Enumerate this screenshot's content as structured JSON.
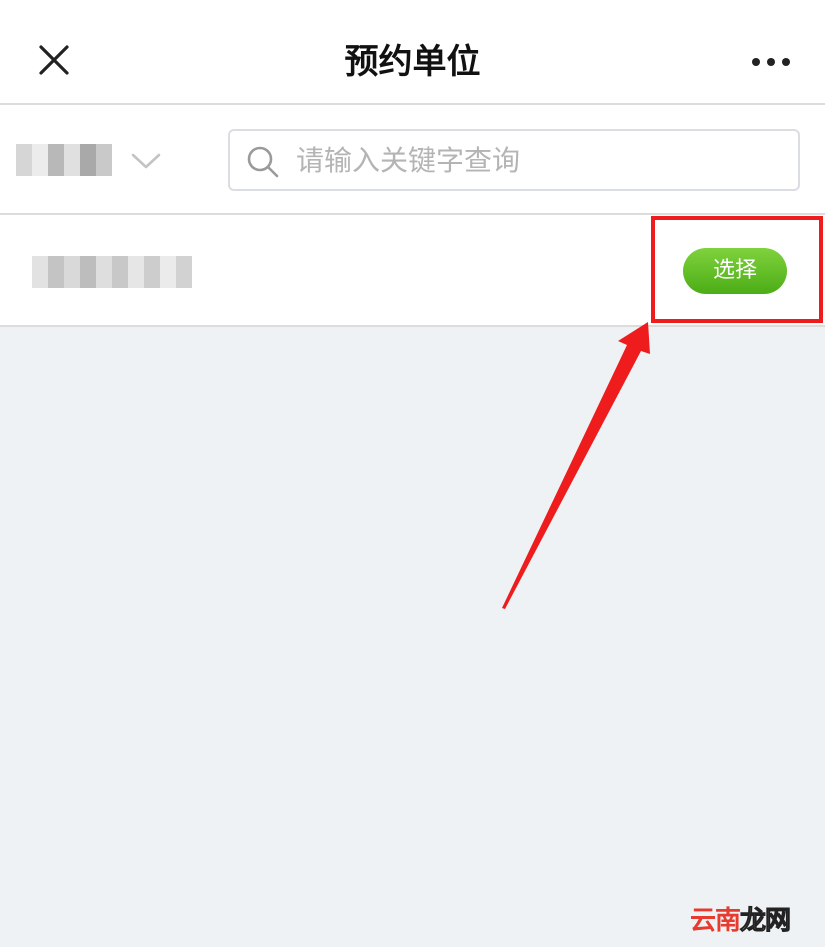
{
  "header": {
    "title": "预约单位",
    "close_icon": "close-icon",
    "more_icon": "more-horizontal-icon"
  },
  "filter": {
    "region_value": "",
    "dropdown_icon": "chevron-down-icon",
    "search": {
      "placeholder": "请输入关键字查询",
      "value": "",
      "icon": "search-icon"
    }
  },
  "results": [
    {
      "name": "",
      "select_label": "选择"
    }
  ],
  "annotation": {
    "highlight_color": "#ee1c1c",
    "arrow_color": "#ee1c1c"
  },
  "watermark": {
    "part1": "云南",
    "part2": "龙网"
  },
  "colors": {
    "background": "#eff2f5",
    "button_green": "#5cbf22"
  }
}
